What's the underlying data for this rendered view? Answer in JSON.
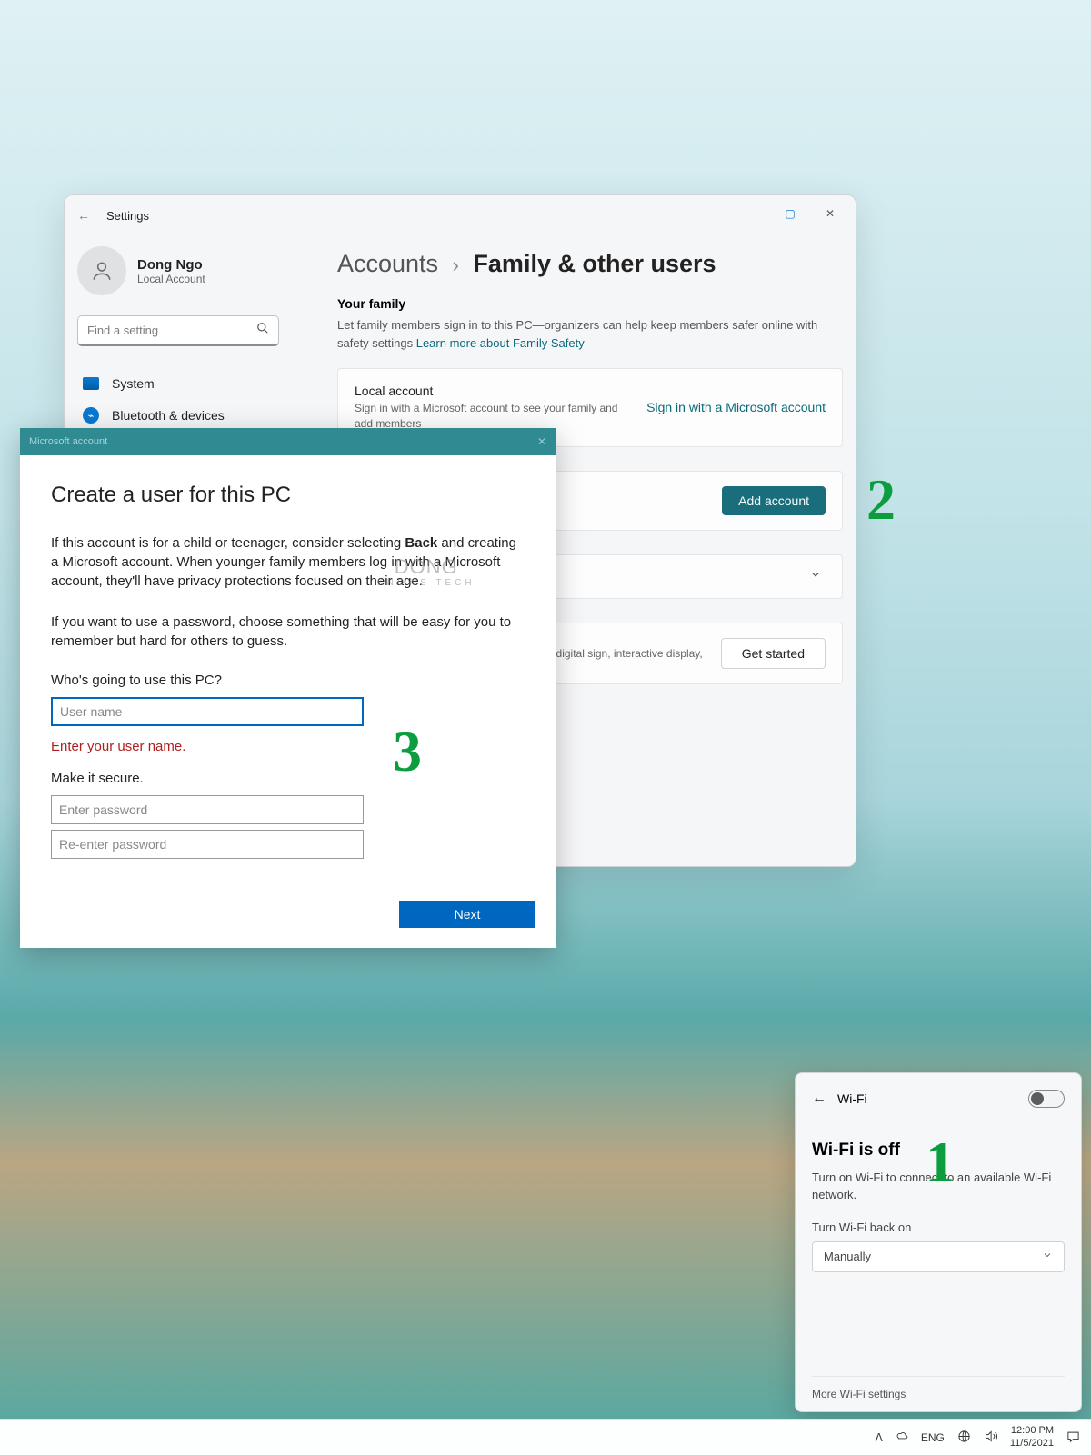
{
  "settings": {
    "back_tooltip": "Back",
    "title": "Settings",
    "profile": {
      "name": "Dong Ngo",
      "sub": "Local Account"
    },
    "search_placeholder": "Find a setting",
    "nav": {
      "system": "System",
      "bluetooth": "Bluetooth & devices"
    },
    "breadcrumb": {
      "parent": "Accounts",
      "current": "Family & other users"
    },
    "family": {
      "heading": "Your family",
      "desc_plain": "Let family members sign in to this PC—organizers can help keep members safer online with safety settings  ",
      "learn_more": "Learn more about Family Safety"
    },
    "local_card": {
      "title": "Local account",
      "sub": "Sign in with a Microsoft account to see your family and add members",
      "link": "Sign in with a Microsoft account"
    },
    "add_account_label": "Add account",
    "kiosk": {
      "desc": "digital sign, interactive display,",
      "btn": "Get started"
    }
  },
  "dialog": {
    "title": "Microsoft account",
    "heading": "Create a user for this PC",
    "para1_a": "If this account is for a child or teenager, consider selecting ",
    "para1_b": "Back",
    "para1_c": " and creating a Microsoft account. When younger family members log in with a Microsoft account, they'll have privacy protections focused on their age.",
    "para2": "If you want to use a password, choose something that will be easy for you to remember but hard for others to guess.",
    "who_label": "Who's going to use this PC?",
    "username_placeholder": "User name",
    "error": "Enter your user name.",
    "secure_label": "Make it secure.",
    "pw1_placeholder": "Enter password",
    "pw2_placeholder": "Re-enter password",
    "next": "Next"
  },
  "wifi": {
    "label": "Wi-Fi",
    "status": "Wi-Fi is off",
    "desc": "Turn on Wi-Fi to connect to an available Wi-Fi network.",
    "back_on": "Turn Wi-Fi back on",
    "select_value": "Manually",
    "more": "More Wi-Fi settings"
  },
  "taskbar": {
    "lang": "ENG",
    "time": "12:00 PM",
    "date": "11/5/2021"
  },
  "annotations": {
    "one": "1",
    "two": "2",
    "three": "3"
  },
  "watermark": {
    "main": "DONG",
    "sub": "KNOWS TECH"
  }
}
